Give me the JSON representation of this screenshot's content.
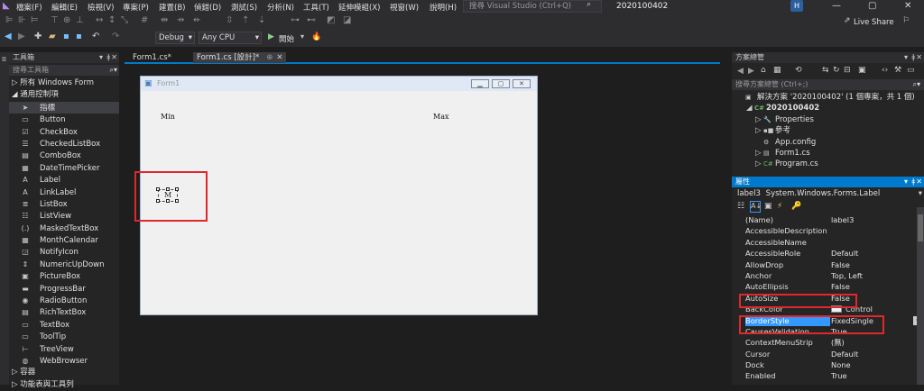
{
  "menu": {
    "items": [
      "檔案(F)",
      "編輯(E)",
      "檢視(V)",
      "專案(P)",
      "建置(B)",
      "偵錯(D)",
      "測試(S)",
      "分析(N)",
      "工具(T)",
      "延伸模組(X)",
      "視窗(W)",
      "說明(H)"
    ],
    "search_placeholder": "搜尋 Visual Studio (Ctrl+Q)",
    "project_name": "2020100402",
    "avatar": "H"
  },
  "toolbar": {
    "config": "Debug",
    "platform": "Any CPU",
    "start_label": "開始",
    "live_share": "Live Share"
  },
  "toolbox": {
    "title": "工具箱",
    "search_placeholder": "搜尋工具箱",
    "group_all": "所有 Windows Form",
    "group_common": "通用控制項",
    "items": [
      {
        "icon": "pointer-icon",
        "glyph": "➤",
        "label": "指標"
      },
      {
        "icon": "button-icon",
        "glyph": "▭",
        "label": "Button"
      },
      {
        "icon": "checkbox-icon",
        "glyph": "☑",
        "label": "CheckBox"
      },
      {
        "icon": "checkedlistbox-icon",
        "glyph": "☰",
        "label": "CheckedListBox"
      },
      {
        "icon": "combobox-icon",
        "glyph": "▤",
        "label": "ComboBox"
      },
      {
        "icon": "datetimepicker-icon",
        "glyph": "▦",
        "label": "DateTimePicker"
      },
      {
        "icon": "label-icon",
        "glyph": "A",
        "label": "Label"
      },
      {
        "icon": "linklabel-icon",
        "glyph": "A",
        "label": "LinkLabel"
      },
      {
        "icon": "listbox-icon",
        "glyph": "≣",
        "label": "ListBox"
      },
      {
        "icon": "listview-icon",
        "glyph": "☷",
        "label": "ListView"
      },
      {
        "icon": "maskedtextbox-icon",
        "glyph": "(.)",
        "label": "MaskedTextBox"
      },
      {
        "icon": "monthcalendar-icon",
        "glyph": "▦",
        "label": "MonthCalendar"
      },
      {
        "icon": "notifyicon-icon",
        "glyph": "◲",
        "label": "NotifyIcon"
      },
      {
        "icon": "numericupdown-icon",
        "glyph": "⇕",
        "label": "NumericUpDown"
      },
      {
        "icon": "picturebox-icon",
        "glyph": "▣",
        "label": "PictureBox"
      },
      {
        "icon": "progressbar-icon",
        "glyph": "▬",
        "label": "ProgressBar"
      },
      {
        "icon": "radiobutton-icon",
        "glyph": "◉",
        "label": "RadioButton"
      },
      {
        "icon": "richtextbox-icon",
        "glyph": "▤",
        "label": "RichTextBox"
      },
      {
        "icon": "textbox-icon",
        "glyph": "▭",
        "label": "TextBox"
      },
      {
        "icon": "tooltip-icon",
        "glyph": "▭",
        "label": "ToolTip"
      },
      {
        "icon": "treeview-icon",
        "glyph": "⊢",
        "label": "TreeView"
      },
      {
        "icon": "webbrowser-icon",
        "glyph": "◍",
        "label": "WebBrowser"
      }
    ],
    "group_containers": "容器",
    "group_menus": "功能表與工具列"
  },
  "tabs": [
    "Form1.cs*",
    "Form1.cs [設計]*"
  ],
  "form": {
    "title": "Form1",
    "min_label": "Min",
    "max_label": "Max",
    "label3_text": "M"
  },
  "solution": {
    "title": "方案總管",
    "search_placeholder": "搜尋方案總管 (Ctrl+;)",
    "tree": [
      {
        "text": "解決方案 '2020100402' (1 個專案，共 1 個)",
        "indent": 0,
        "icon": "solution-icon",
        "glyph": "▣"
      },
      {
        "text": "2020100402",
        "indent": 1,
        "icon": "csproj-icon",
        "glyph": "C#"
      },
      {
        "text": "Properties",
        "indent": 2,
        "icon": "wrench-icon",
        "glyph": "🔧"
      },
      {
        "text": "參考",
        "indent": 2,
        "icon": "references-icon",
        "glyph": "▪■"
      },
      {
        "text": "App.config",
        "indent": 2,
        "icon": "config-icon",
        "glyph": "⚙"
      },
      {
        "text": "Form1.cs",
        "indent": 2,
        "icon": "form-icon",
        "glyph": "▤"
      },
      {
        "text": "Program.cs",
        "indent": 2,
        "icon": "csfile-icon",
        "glyph": "C#"
      }
    ]
  },
  "properties": {
    "title": "屬性",
    "object": "label3",
    "object_type": "System.Windows.Forms.Label",
    "rows": [
      {
        "name": "(Name)",
        "value": "label3"
      },
      {
        "name": "AccessibleDescription",
        "value": ""
      },
      {
        "name": "AccessibleName",
        "value": ""
      },
      {
        "name": "AccessibleRole",
        "value": "Default"
      },
      {
        "name": "AllowDrop",
        "value": "False"
      },
      {
        "name": "Anchor",
        "value": "Top, Left"
      },
      {
        "name": "AutoEllipsis",
        "value": "False"
      },
      {
        "name": "AutoSize",
        "value": "False"
      },
      {
        "name": "BackColor",
        "value": "Control"
      },
      {
        "name": "BorderStyle",
        "value": "FixedSingle"
      },
      {
        "name": "CausesValidation",
        "value": "True"
      },
      {
        "name": "ContextMenuStrip",
        "value": "(無)"
      },
      {
        "name": "Cursor",
        "value": "Default"
      },
      {
        "name": "Dock",
        "value": "None"
      },
      {
        "name": "Enabled",
        "value": "True"
      }
    ]
  },
  "colors": {
    "accent": "#007acc",
    "highlight": "#e0282c",
    "selected": "#3399ff"
  }
}
